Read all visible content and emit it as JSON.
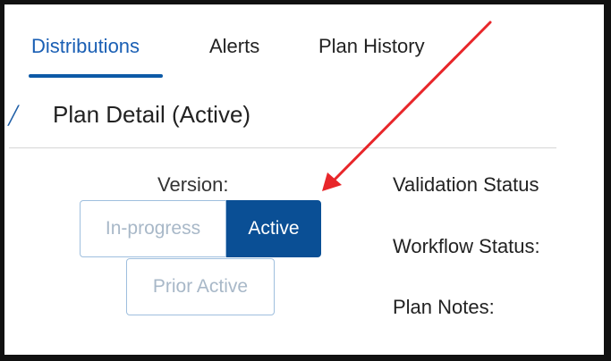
{
  "tabs": [
    {
      "label": "Distributions",
      "active": true
    },
    {
      "label": "Alerts",
      "active": false
    },
    {
      "label": "Plan History",
      "active": false
    }
  ],
  "section": {
    "title": "Plan Detail (Active)"
  },
  "version": {
    "label": "Version:",
    "options": [
      {
        "label": "In-progress",
        "selected": false
      },
      {
        "label": "Active",
        "selected": true
      },
      {
        "label": "Prior Active",
        "selected": false
      }
    ]
  },
  "fields": {
    "validation_status": "Validation Status",
    "workflow_status": "Workflow Status:",
    "plan_notes": "Plan Notes:"
  },
  "annotation": {
    "type": "arrow",
    "color": "#e8262a"
  },
  "colors": {
    "accent": "#0a4f95",
    "tab_active": "#1a5fb4",
    "inactive_button_text": "#a8b8c8",
    "inactive_button_border": "#9fbfde"
  }
}
